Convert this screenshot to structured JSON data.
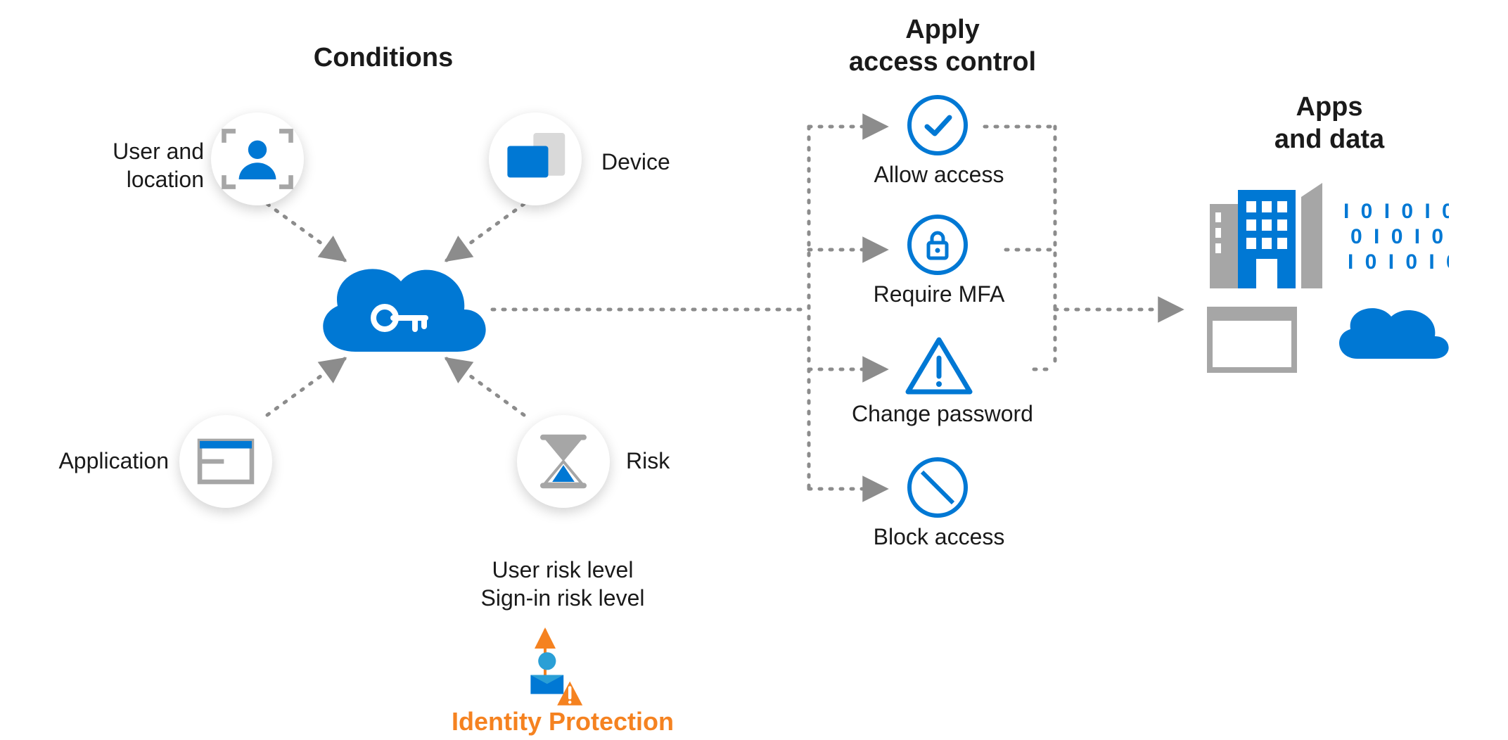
{
  "sections": {
    "conditions_title": "Conditions",
    "access_title_line1": "Apply",
    "access_title_line2": "access control",
    "apps_title_line1": "Apps",
    "apps_title_line2": "and data"
  },
  "conditions": {
    "user_location_line1": "User and",
    "user_location_line2": "location",
    "device": "Device",
    "application": "Application",
    "risk": "Risk",
    "risk_detail_line1": "User risk level",
    "risk_detail_line2": "Sign-in risk level",
    "identity_protection": "Identity Protection"
  },
  "access_controls": {
    "allow": "Allow access",
    "mfa": "Require MFA",
    "change_pw": "Change password",
    "block": "Block access"
  },
  "colors": {
    "brand_blue": "#0078d4",
    "gray": "#a6a6a6",
    "orange": "#f58220",
    "text": "#1a1a1a"
  }
}
